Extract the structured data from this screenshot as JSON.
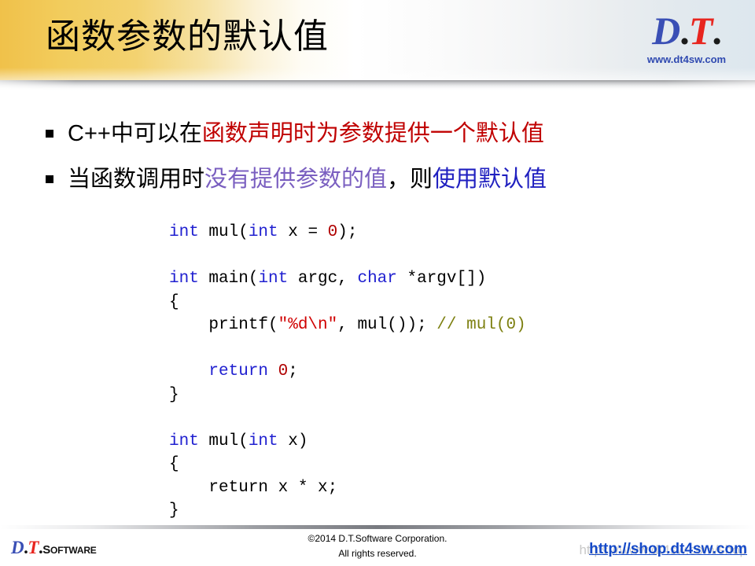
{
  "slide": {
    "title": "函数参数的默认值"
  },
  "brand": {
    "mark_d": "D",
    "mark_dot1": ".",
    "mark_t": "T",
    "mark_dot2": ".",
    "url": "www.dt4sw.com"
  },
  "bullets": [
    {
      "marker": "square-bullet",
      "segments": [
        {
          "text": "C++中可以在",
          "color": "#000000",
          "class": "c-black"
        },
        {
          "text": "函数声明时为参数提供一个默认值",
          "color": "#c00000",
          "class": "c-red"
        }
      ]
    },
    {
      "marker": "square-bullet",
      "segments": [
        {
          "text": "当函数调用时",
          "color": "#000000",
          "class": "c-black"
        },
        {
          "text": "没有提供参数的值",
          "color": "#7a5fc0",
          "class": "c-purple"
        },
        {
          "text": "，则",
          "color": "#000000",
          "class": "c-black"
        },
        {
          "text": "使用默认值",
          "color": "#2020c0",
          "class": "c-blue"
        }
      ]
    }
  ],
  "code": {
    "language": "c",
    "lines": [
      [
        {
          "t": "int",
          "c": "kw"
        },
        {
          "t": " mul(",
          "c": "pl"
        },
        {
          "t": "int",
          "c": "kw"
        },
        {
          "t": " x = ",
          "c": "pl"
        },
        {
          "t": "0",
          "c": "num"
        },
        {
          "t": ");",
          "c": "pl"
        }
      ],
      [
        {
          "t": "",
          "c": "pl"
        }
      ],
      [
        {
          "t": "int",
          "c": "kw"
        },
        {
          "t": " main(",
          "c": "pl"
        },
        {
          "t": "int",
          "c": "kw"
        },
        {
          "t": " argc, ",
          "c": "pl"
        },
        {
          "t": "char",
          "c": "kw"
        },
        {
          "t": " *argv[])",
          "c": "pl"
        }
      ],
      [
        {
          "t": "{",
          "c": "pl"
        }
      ],
      [
        {
          "t": "    printf(",
          "c": "pl"
        },
        {
          "t": "\"%d\\n\"",
          "c": "str"
        },
        {
          "t": ", mul()); ",
          "c": "pl"
        },
        {
          "t": "// mul(0)",
          "c": "cmt"
        }
      ],
      [
        {
          "t": "",
          "c": "pl"
        }
      ],
      [
        {
          "t": "    ",
          "c": "pl"
        },
        {
          "t": "return",
          "c": "kw"
        },
        {
          "t": " ",
          "c": "pl"
        },
        {
          "t": "0",
          "c": "num"
        },
        {
          "t": ";",
          "c": "pl"
        }
      ],
      [
        {
          "t": "}",
          "c": "pl"
        }
      ],
      [
        {
          "t": "",
          "c": "pl"
        }
      ],
      [
        {
          "t": "int",
          "c": "kw"
        },
        {
          "t": " mul(",
          "c": "pl"
        },
        {
          "t": "int",
          "c": "kw"
        },
        {
          "t": " x)",
          "c": "pl"
        }
      ],
      [
        {
          "t": "{",
          "c": "pl"
        }
      ],
      [
        {
          "t": "    return x * x;",
          "c": "pl"
        }
      ],
      [
        {
          "t": "}",
          "c": "pl"
        }
      ]
    ]
  },
  "footer": {
    "logo_d": "D",
    "logo_dot1": ".",
    "logo_t": "T",
    "logo_dot2": ".",
    "logo_word_first": "S",
    "logo_word_rest": "OFTWARE",
    "copyright_line1": "©2014 D.T.Software Corporation.",
    "copyright_line2": "All rights reserved.",
    "link_ghost": "https://www.dt4sw.com/shop",
    "link": "http://shop.dt4sw.com"
  },
  "colors": {
    "header_gold": "#f0c14a",
    "brand_blue": "#3a4fb5",
    "brand_red": "#e8251f",
    "accent_red": "#c00000",
    "accent_purple": "#7a5fc0",
    "accent_blue": "#2020c0",
    "code_keyword": "#2020d0",
    "code_string": "#d00000",
    "code_comment": "#7d8011",
    "link_blue": "#1449c8"
  }
}
